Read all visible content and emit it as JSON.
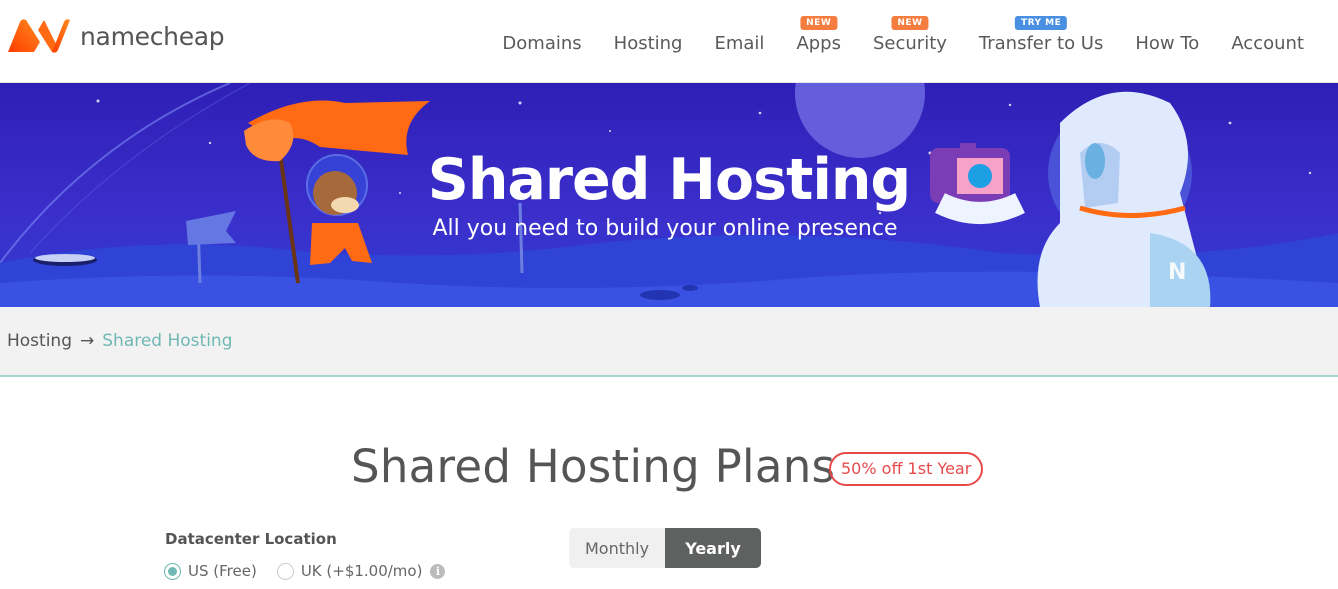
{
  "brand": {
    "name": "namecheap",
    "accent": "#ff5f00"
  },
  "nav": [
    {
      "label": "Domains",
      "badge": ""
    },
    {
      "label": "Hosting",
      "badge": ""
    },
    {
      "label": "Email",
      "badge": ""
    },
    {
      "label": "Apps",
      "badge": "NEW"
    },
    {
      "label": "Security",
      "badge": "NEW"
    },
    {
      "label": "Transfer to Us",
      "badge": "TRY ME"
    },
    {
      "label": "How To",
      "badge": ""
    },
    {
      "label": "Account",
      "badge": ""
    }
  ],
  "hero": {
    "title": "Shared Hosting",
    "subtitle": "All you need to build your online presence"
  },
  "breadcrumb": {
    "parent": "Hosting",
    "separator": "→",
    "current": "Shared Hosting"
  },
  "plans": {
    "title": "Shared Hosting Plans",
    "promo": "50% off 1st Year",
    "datacenter_label": "Datacenter Location",
    "locations": [
      {
        "label": "US (Free)",
        "selected": true
      },
      {
        "label": "UK (+$1.00/mo)",
        "selected": false
      }
    ],
    "info_icon": "i",
    "billing": {
      "options": [
        "Monthly",
        "Yearly"
      ],
      "selected": "Yearly"
    }
  }
}
